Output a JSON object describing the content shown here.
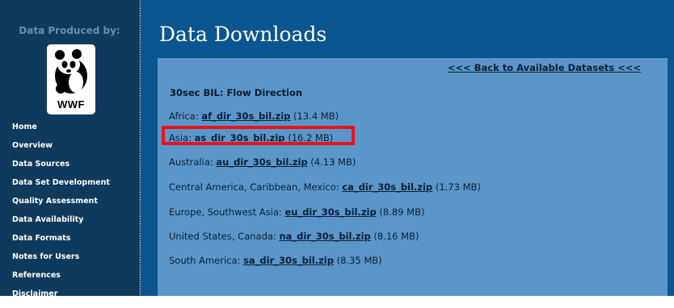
{
  "sidebar": {
    "header": "Data Produced by:",
    "logo_text": "WWF",
    "nav": [
      "Home",
      "Overview",
      "Data Sources",
      "Data Set Development",
      "Quality Assessment",
      "Data Availability",
      "Data Formats",
      "Notes for Users",
      "References",
      "Disclaimer"
    ]
  },
  "main": {
    "title": "Data Downloads",
    "back_link": "<<< Back to Available Datasets <<<",
    "section_title": "30sec BIL: Flow Direction",
    "downloads": [
      {
        "region": "Africa: ",
        "file": "af_dir_30s_bil.zip",
        "size": " (13.4 MB)"
      },
      {
        "region": "Asia: ",
        "file": "as_dir_30s_bil.zip",
        "size": " (16.2 MB)"
      },
      {
        "region": "Australia: ",
        "file": "au_dir_30s_bil.zip",
        "size": " (4.13 MB)"
      },
      {
        "region": "Central America, Caribbean, Mexico: ",
        "file": "ca_dir_30s_bil.zip",
        "size": " (1.73 MB)"
      },
      {
        "region": "Europe, Southwest Asia: ",
        "file": "eu_dir_30s_bil.zip",
        "size": " (8.89 MB)"
      },
      {
        "region": "United States, Canada: ",
        "file": "na_dir_30s_bil.zip",
        "size": " (8.16 MB)"
      },
      {
        "region": "South America: ",
        "file": "sa_dir_30s_bil.zip",
        "size": " (8.35 MB)"
      }
    ],
    "highlight_color": "#e8141c"
  },
  "colors": {
    "sidebar_bg": "#0f3a5c",
    "main_bg": "#0b5591",
    "content_bg": "#5a96c9"
  },
  "icons": {
    "logo": "panda-logo-icon"
  }
}
